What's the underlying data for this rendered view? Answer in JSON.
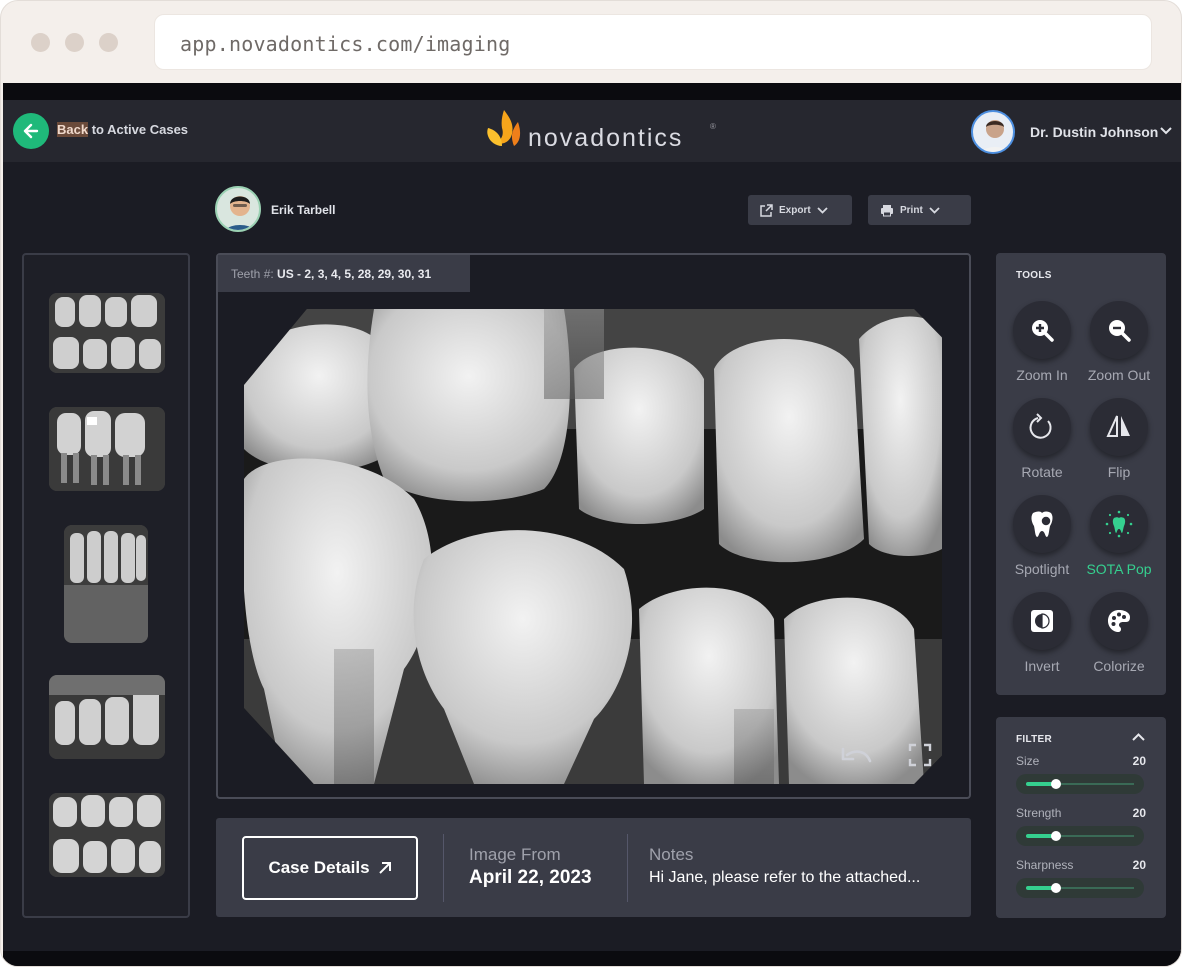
{
  "browser": {
    "url": "app.novadontics.com/imaging"
  },
  "header": {
    "back_prefix": "Back",
    "back_suffix": " to Active Cases",
    "logo_text": "novadontics",
    "logo_reg": "®",
    "user_name": "Dr. Dustin Johnson"
  },
  "patient": {
    "name": "Erik Tarbell"
  },
  "toolbar": {
    "export_label": "Export",
    "print_label": "Print"
  },
  "viewer": {
    "teeth_label": "Teeth #:",
    "teeth_value": " US - 2, 3, 4, 5, 28, 29, 30, 31"
  },
  "details": {
    "case_details_label": "Case Details",
    "image_from_label": "Image From",
    "image_date": "April 22, 2023",
    "notes_label": "Notes",
    "notes_text": "Hi Jane, please refer to the attached..."
  },
  "tools": {
    "title": "TOOLS",
    "items": [
      {
        "label": "Zoom In",
        "icon": "zoom-in-icon"
      },
      {
        "label": "Zoom Out",
        "icon": "zoom-out-icon"
      },
      {
        "label": "Rotate",
        "icon": "rotate-icon"
      },
      {
        "label": "Flip",
        "icon": "flip-icon"
      },
      {
        "label": "Spotlight",
        "icon": "tooth-spotlight-icon"
      },
      {
        "label": "SOTA Pop",
        "icon": "sparkle-tooth-icon",
        "active": true
      },
      {
        "label": "Invert",
        "icon": "invert-icon"
      },
      {
        "label": "Colorize",
        "icon": "palette-icon"
      }
    ]
  },
  "filter": {
    "title": "FILTER",
    "sliders": [
      {
        "label": "Size",
        "value": "20",
        "level": 0.28
      },
      {
        "label": "Strength",
        "value": "20",
        "level": 0.28
      },
      {
        "label": "Sharpness",
        "value": "20",
        "level": 0.28
      }
    ]
  },
  "colors": {
    "accent": "#35d08f",
    "panel": "#3a3c47",
    "background": "#1b1c24"
  }
}
